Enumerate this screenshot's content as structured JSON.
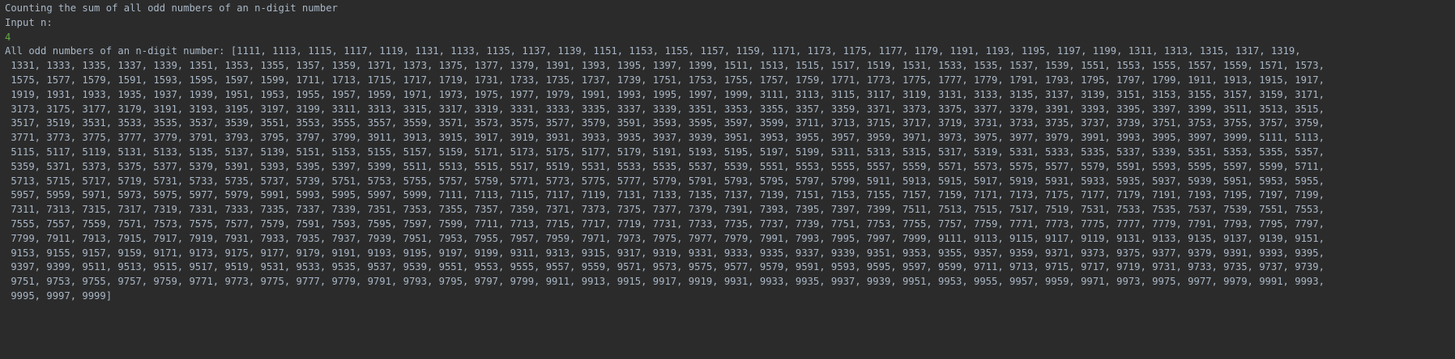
{
  "console": {
    "line_title": "Counting the sum of all odd numbers of an n-digit number",
    "line_prompt": "Input n:",
    "user_input": "4",
    "output_lines": [
      "All odd numbers of an n-digit number: [1111, 1113, 1115, 1117, 1119, 1131, 1133, 1135, 1137, 1139, 1151, 1153, 1155, 1157, 1159, 1171, 1173, 1175, 1177, 1179, 1191, 1193, 1195, 1197, 1199, 1311, 1313, 1315, 1317, 1319,",
      " 1331, 1333, 1335, 1337, 1339, 1351, 1353, 1355, 1357, 1359, 1371, 1373, 1375, 1377, 1379, 1391, 1393, 1395, 1397, 1399, 1511, 1513, 1515, 1517, 1519, 1531, 1533, 1535, 1537, 1539, 1551, 1553, 1555, 1557, 1559, 1571, 1573,",
      " 1575, 1577, 1579, 1591, 1593, 1595, 1597, 1599, 1711, 1713, 1715, 1717, 1719, 1731, 1733, 1735, 1737, 1739, 1751, 1753, 1755, 1757, 1759, 1771, 1773, 1775, 1777, 1779, 1791, 1793, 1795, 1797, 1799, 1911, 1913, 1915, 1917,",
      " 1919, 1931, 1933, 1935, 1937, 1939, 1951, 1953, 1955, 1957, 1959, 1971, 1973, 1975, 1977, 1979, 1991, 1993, 1995, 1997, 1999, 3111, 3113, 3115, 3117, 3119, 3131, 3133, 3135, 3137, 3139, 3151, 3153, 3155, 3157, 3159, 3171,",
      " 3173, 3175, 3177, 3179, 3191, 3193, 3195, 3197, 3199, 3311, 3313, 3315, 3317, 3319, 3331, 3333, 3335, 3337, 3339, 3351, 3353, 3355, 3357, 3359, 3371, 3373, 3375, 3377, 3379, 3391, 3393, 3395, 3397, 3399, 3511, 3513, 3515,",
      " 3517, 3519, 3531, 3533, 3535, 3537, 3539, 3551, 3553, 3555, 3557, 3559, 3571, 3573, 3575, 3577, 3579, 3591, 3593, 3595, 3597, 3599, 3711, 3713, 3715, 3717, 3719, 3731, 3733, 3735, 3737, 3739, 3751, 3753, 3755, 3757, 3759,",
      " 3771, 3773, 3775, 3777, 3779, 3791, 3793, 3795, 3797, 3799, 3911, 3913, 3915, 3917, 3919, 3931, 3933, 3935, 3937, 3939, 3951, 3953, 3955, 3957, 3959, 3971, 3973, 3975, 3977, 3979, 3991, 3993, 3995, 3997, 3999, 5111, 5113,",
      " 5115, 5117, 5119, 5131, 5133, 5135, 5137, 5139, 5151, 5153, 5155, 5157, 5159, 5171, 5173, 5175, 5177, 5179, 5191, 5193, 5195, 5197, 5199, 5311, 5313, 5315, 5317, 5319, 5331, 5333, 5335, 5337, 5339, 5351, 5353, 5355, 5357,",
      " 5359, 5371, 5373, 5375, 5377, 5379, 5391, 5393, 5395, 5397, 5399, 5511, 5513, 5515, 5517, 5519, 5531, 5533, 5535, 5537, 5539, 5551, 5553, 5555, 5557, 5559, 5571, 5573, 5575, 5577, 5579, 5591, 5593, 5595, 5597, 5599, 5711,",
      " 5713, 5715, 5717, 5719, 5731, 5733, 5735, 5737, 5739, 5751, 5753, 5755, 5757, 5759, 5771, 5773, 5775, 5777, 5779, 5791, 5793, 5795, 5797, 5799, 5911, 5913, 5915, 5917, 5919, 5931, 5933, 5935, 5937, 5939, 5951, 5953, 5955,",
      " 5957, 5959, 5971, 5973, 5975, 5977, 5979, 5991, 5993, 5995, 5997, 5999, 7111, 7113, 7115, 7117, 7119, 7131, 7133, 7135, 7137, 7139, 7151, 7153, 7155, 7157, 7159, 7171, 7173, 7175, 7177, 7179, 7191, 7193, 7195, 7197, 7199,",
      " 7311, 7313, 7315, 7317, 7319, 7331, 7333, 7335, 7337, 7339, 7351, 7353, 7355, 7357, 7359, 7371, 7373, 7375, 7377, 7379, 7391, 7393, 7395, 7397, 7399, 7511, 7513, 7515, 7517, 7519, 7531, 7533, 7535, 7537, 7539, 7551, 7553,",
      " 7555, 7557, 7559, 7571, 7573, 7575, 7577, 7579, 7591, 7593, 7595, 7597, 7599, 7711, 7713, 7715, 7717, 7719, 7731, 7733, 7735, 7737, 7739, 7751, 7753, 7755, 7757, 7759, 7771, 7773, 7775, 7777, 7779, 7791, 7793, 7795, 7797,",
      " 7799, 7911, 7913, 7915, 7917, 7919, 7931, 7933, 7935, 7937, 7939, 7951, 7953, 7955, 7957, 7959, 7971, 7973, 7975, 7977, 7979, 7991, 7993, 7995, 7997, 7999, 9111, 9113, 9115, 9117, 9119, 9131, 9133, 9135, 9137, 9139, 9151,",
      " 9153, 9155, 9157, 9159, 9171, 9173, 9175, 9177, 9179, 9191, 9193, 9195, 9197, 9199, 9311, 9313, 9315, 9317, 9319, 9331, 9333, 9335, 9337, 9339, 9351, 9353, 9355, 9357, 9359, 9371, 9373, 9375, 9377, 9379, 9391, 9393, 9395,",
      " 9397, 9399, 9511, 9513, 9515, 9517, 9519, 9531, 9533, 9535, 9537, 9539, 9551, 9553, 9555, 9557, 9559, 9571, 9573, 9575, 9577, 9579, 9591, 9593, 9595, 9597, 9599, 9711, 9713, 9715, 9717, 9719, 9731, 9733, 9735, 9737, 9739,",
      " 9751, 9753, 9755, 9757, 9759, 9771, 9773, 9775, 9777, 9779, 9791, 9793, 9795, 9797, 9799, 9911, 9913, 9915, 9917, 9919, 9931, 9933, 9935, 9937, 9939, 9951, 9953, 9955, 9957, 9959, 9971, 9973, 9975, 9977, 9979, 9991, 9993,",
      " 9995, 9997, 9999]"
    ],
    "colors": {
      "background": "#2b2b2b",
      "output_text": "#a9b7c6",
      "user_input": "#62a844"
    }
  }
}
